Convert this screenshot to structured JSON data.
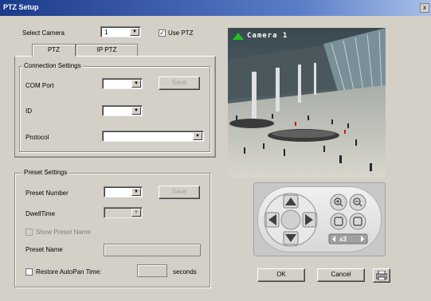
{
  "window": {
    "title": "PTZ Setup",
    "close_label": "x"
  },
  "top": {
    "select_camera_label": "Select Camera",
    "select_camera_value": "1",
    "use_ptz_label": "Use PTZ",
    "use_ptz_checked": true
  },
  "tabs": [
    {
      "label": "PTZ"
    },
    {
      "label": "IP PTZ"
    }
  ],
  "connection": {
    "title": "Connection Settings",
    "com_port_label": "COM Port",
    "com_port_value": "",
    "save_label": "Save",
    "id_label": "ID",
    "id_value": "",
    "protocol_label": "Protocol",
    "protocol_value": ""
  },
  "preset": {
    "title": "Preset Settings",
    "preset_number_label": "Preset Number",
    "preset_number_value": "",
    "save_label": "Save",
    "dwell_time_label": "DwellTime",
    "dwell_time_value": "",
    "show_preset_name_label": "Show Preset Name",
    "preset_name_label": "Preset Name",
    "preset_name_value": "",
    "restore_autopan_label": "Restore AutoPan Time:",
    "restore_autopan_value": "",
    "seconds_label": "seconds"
  },
  "video": {
    "camera_label": "Camera 1"
  },
  "ptz": {
    "speed_label": "x3"
  },
  "buttons": {
    "ok_label": "OK",
    "cancel_label": "Cancel"
  },
  "icons": {
    "up": "arrow-up-icon",
    "down": "arrow-down-icon",
    "left": "arrow-left-icon",
    "right": "arrow-right-icon",
    "zoom_in": "zoom-in-icon",
    "zoom_out": "zoom-out-icon",
    "focus_near": "focus-near-icon",
    "focus_far": "focus-far-icon",
    "printer": "printer-icon"
  },
  "colors": {
    "titlebar": "#1c3a8a",
    "camera_indicator": "#22c022"
  }
}
